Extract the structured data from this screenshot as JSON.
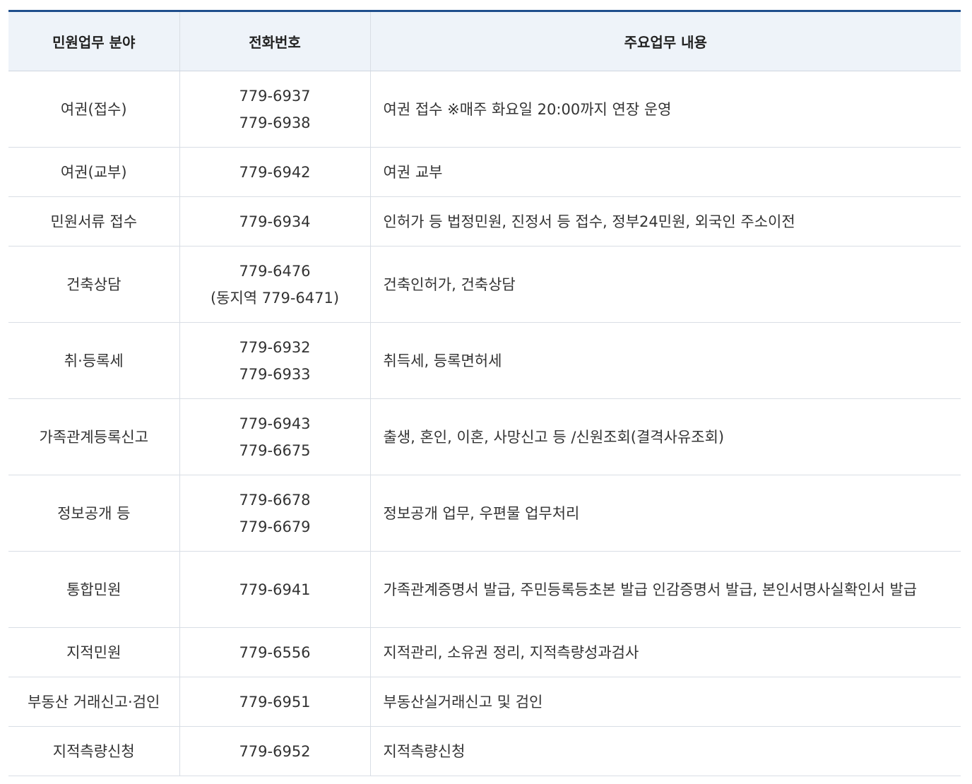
{
  "table": {
    "headers": [
      "민원업무 분야",
      "전화번호",
      "주요업무 내용"
    ],
    "rows": [
      {
        "field": "여권(접수)",
        "phones": [
          "779-6937",
          "779-6938"
        ],
        "desc": "여권 접수 ※매주 화요일 20:00까지 연장 운영"
      },
      {
        "field": "여권(교부)",
        "phones": [
          "779-6942"
        ],
        "desc": "여권 교부"
      },
      {
        "field": "민원서류 접수",
        "phones": [
          "779-6934"
        ],
        "desc": "인허가 등 법정민원, 진정서 등 접수, 정부24민원, 외국인 주소이전"
      },
      {
        "field": "건축상담",
        "phones": [
          "779-6476",
          "(동지역 779-6471)"
        ],
        "desc": "건축인허가, 건축상담"
      },
      {
        "field": "취·등록세",
        "phones": [
          "779-6932",
          "779-6933"
        ],
        "desc": "취득세, 등록면허세"
      },
      {
        "field": "가족관계등록신고",
        "phones": [
          "779-6943",
          "779-6675"
        ],
        "desc": "출생, 혼인, 이혼, 사망신고 등 /신원조회(결격사유조회)"
      },
      {
        "field": "정보공개 등",
        "phones": [
          "779-6678",
          "779-6679"
        ],
        "desc": "정보공개 업무, 우편물 업무처리"
      },
      {
        "field": "통합민원",
        "phones": [
          "779-6941"
        ],
        "desc": "가족관계증명서 발급, 주민등록등초본 발급 인감증명서 발급, 본인서명사실확인서 발급"
      },
      {
        "field": "지적민원",
        "phones": [
          "779-6556"
        ],
        "desc": "지적관리, 소유권 정리, 지적측량성과검사"
      },
      {
        "field": "부동산 거래신고·검인",
        "phones": [
          "779-6951"
        ],
        "desc": "부동산실거래신고 및 검인"
      },
      {
        "field": "지적측량신청",
        "phones": [
          "779-6952"
        ],
        "desc": "지적측량신청"
      }
    ]
  }
}
